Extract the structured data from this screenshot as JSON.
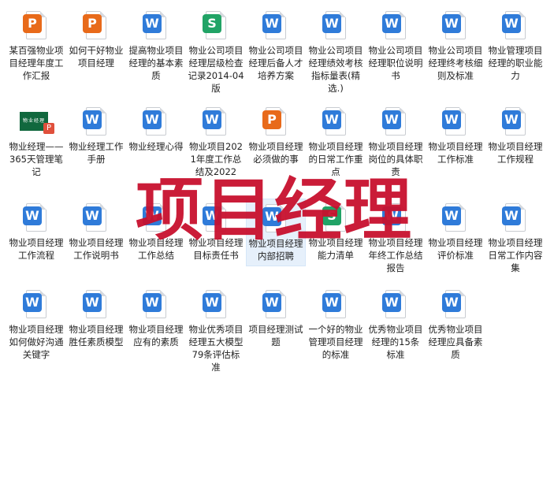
{
  "watermark": "项目经理",
  "files": [
    {
      "label": "某百强物业项目经理年度工作汇报",
      "type": "p"
    },
    {
      "label": "如何干好物业项目经理",
      "type": "p"
    },
    {
      "label": "提高物业项目经理的基本素质",
      "type": "w"
    },
    {
      "label": "物业公司项目经理层级检查记录2014-04版",
      "type": "s"
    },
    {
      "label": "物业公司项目经理后备人才培养方案",
      "type": "w"
    },
    {
      "label": "物业公司项目经理绩效考核指标量表(精选.)",
      "type": "w"
    },
    {
      "label": "物业公司项目经理职位说明书",
      "type": "w"
    },
    {
      "label": "物业公司项目经理终考核细则及标准",
      "type": "w"
    },
    {
      "label": "物业管理项目经理的职业能力",
      "type": "w"
    },
    {
      "label": "物业经理——365天管理笔记",
      "type": "thumb"
    },
    {
      "label": "物业经理工作手册",
      "type": "w"
    },
    {
      "label": "物业经理心得",
      "type": "w"
    },
    {
      "label": "物业项目2021年度工作总结及2022",
      "type": "w"
    },
    {
      "label": "物业项目经理必须做的事",
      "type": "p"
    },
    {
      "label": "物业项目经理的日常工作重点",
      "type": "w"
    },
    {
      "label": "物业项目经理岗位的具体职责",
      "type": "w"
    },
    {
      "label": "物业项目经理工作标准",
      "type": "w"
    },
    {
      "label": "物业项目经理工作规程",
      "type": "w"
    },
    {
      "label": "物业项目经理工作流程",
      "type": "w"
    },
    {
      "label": "物业项目经理工作说明书",
      "type": "w"
    },
    {
      "label": "物业项目经理工作总结",
      "type": "w"
    },
    {
      "label": "物业项目经理目标责任书",
      "type": "w"
    },
    {
      "label": "物业项目经理内部招聘",
      "type": "w",
      "selected": true
    },
    {
      "label": "物业项目经理能力清单",
      "type": "s"
    },
    {
      "label": "物业项目经理年终工作总结报告",
      "type": "w"
    },
    {
      "label": "物业项目经理评价标准",
      "type": "w"
    },
    {
      "label": "物业项目经理日常工作内容集",
      "type": "w"
    },
    {
      "label": "物业项目经理如何做好沟通关键字",
      "type": "w"
    },
    {
      "label": "物业项目经理胜任素质模型",
      "type": "w"
    },
    {
      "label": "物业项目经理应有的素质",
      "type": "w"
    },
    {
      "label": "物业优秀项目经理五大模型79条评估标准",
      "type": "w"
    },
    {
      "label": "项目经理测试题",
      "type": "w"
    },
    {
      "label": "一个好的物业管理项目经理的标准",
      "type": "w"
    },
    {
      "label": "优秀物业项目经理的15条标准",
      "type": "w"
    },
    {
      "label": "优秀物业项目经理应具备素质",
      "type": "w"
    }
  ],
  "badge_letters": {
    "w": "W",
    "p": "P",
    "s": "S",
    "thumb": "物业经理"
  }
}
